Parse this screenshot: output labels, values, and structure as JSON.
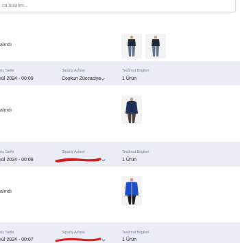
{
  "search": {
    "placeholder": "ca bulalım..."
  },
  "orders": [
    {
      "status": "alındı",
      "products": [
        {
          "icon": "navy-sweater-jeans-outfit-photo-icon"
        },
        {
          "icon": "navy-sweater-jeans-outfit-photo-icon"
        }
      ]
    },
    {
      "header": {
        "date_label": "riş Tarihi",
        "date_value": "ıül 2024 - 00:09",
        "address_label": "Sipariş Adresi",
        "address_value": "Coşkun Züccaciye",
        "delivery_label": "Teslimat Bilgileri",
        "delivery_value": "1 Ürün"
      },
      "status": "alındı",
      "products": [
        {
          "icon": "navy-puffer-jacket-photo-icon"
        }
      ]
    },
    {
      "header": {
        "date_label": "riş Tarihi",
        "date_value": "ıül 2024 - 00:08",
        "address_label": "Sipariş Adresi",
        "delivery_label": "Teslimat Bilgileri",
        "delivery_value": "1 Ürün"
      },
      "status": "alındı",
      "products": [
        {
          "icon": "blue-zip-jacket-photo-icon"
        }
      ]
    },
    {
      "header": {
        "date_label": "riş Tarihi",
        "date_value": "ıül 2024 - 00:07",
        "address_label": "Sipariş Adresi",
        "delivery_label": "Teslimat Bilgileri",
        "delivery_value": "1 Ürün"
      }
    }
  ],
  "colors": {
    "header_bg": "#eaecf6",
    "label": "#7a7f96",
    "redaction": "#d11a1a"
  }
}
